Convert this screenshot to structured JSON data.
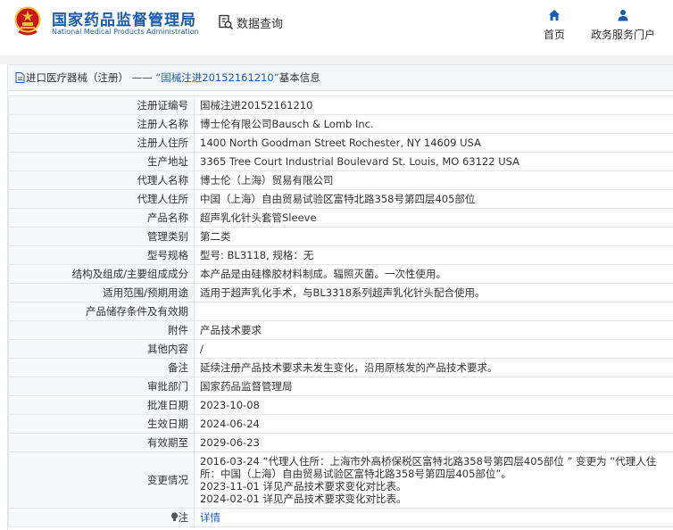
{
  "header": {
    "logo_cn": "国家药品监督管理局",
    "logo_en": "National Medical Products Administration",
    "search_label": "数据查询",
    "nav": [
      {
        "label": "首页",
        "icon": "home-icon"
      },
      {
        "label": "政务服务门户",
        "icon": "user-icon"
      }
    ]
  },
  "panel": {
    "title_category": "进口医疗器械（注册）",
    "title_separator": " —— ",
    "title_number": "“国械注进20152161210”",
    "title_suffix": "基本信息"
  },
  "rows": [
    {
      "label": "注册证编号",
      "value": "国械注进20152161210"
    },
    {
      "label": "注册人名称",
      "value": "博士伦有限公司Bausch & Lomb Inc."
    },
    {
      "label": "注册人住所",
      "value": "1400 North Goodman Street Rochester, NY 14609 USA"
    },
    {
      "label": "生产地址",
      "value": "3365 Tree Court Industrial Boulevard St. Louis, MO 63122 USA"
    },
    {
      "label": "代理人名称",
      "value": "博士伦（上海）贸易有限公司"
    },
    {
      "label": "代理人住所",
      "value": "中国（上海）自由贸易试验区富特北路358号第四层405部位"
    },
    {
      "label": "产品名称",
      "value": "超声乳化针头套管Sleeve"
    },
    {
      "label": "管理类别",
      "value": "第二类"
    },
    {
      "label": "型号规格",
      "value": "型号: BL3118, 规格：无"
    },
    {
      "label": "结构及组成/主要组成成分",
      "value": "本产品是由硅橡胶材料制成。辐照灭菌。一次性使用。"
    },
    {
      "label": "适用范围/预期用途",
      "value": "适用于超声乳化手术，与BL3318系列超声乳化针头配合使用。"
    },
    {
      "label": "产品储存条件及有效期",
      "value": ""
    },
    {
      "label": "附件",
      "value": "产品技术要求"
    },
    {
      "label": "其他内容",
      "value": "/"
    },
    {
      "label": "备注",
      "value": "延续注册产品技术要求未发生变化，沿用原核发的产品技术要求。"
    },
    {
      "label": "审批部门",
      "value": "国家药品监督管理局"
    },
    {
      "label": "批准日期",
      "value": "2023-10-08"
    },
    {
      "label": "生效日期",
      "value": "2024-06-24"
    },
    {
      "label": "有效期至",
      "value": "2029-06-23"
    }
  ],
  "changes": {
    "label": "变更情况",
    "lines": [
      "2016-03-24 “代理人住所：上海市外高桥保税区富特北路358号第四层405部位 ” 变更为 “代理人住所：中国（上海）自由贸易试验区富特北路358号第四层405部位”。",
      "2023-11-01 详见产品技术要求变化对比表。",
      "2024-02-01 详见产品技术要求变化对比表。"
    ]
  },
  "note": {
    "label": "注",
    "link": "详情",
    "icon": "lightbulb-icon"
  },
  "colors": {
    "brand_blue": "#1b5dab",
    "emblem_red": "#c8161d",
    "emblem_gold": "#f4c430"
  }
}
